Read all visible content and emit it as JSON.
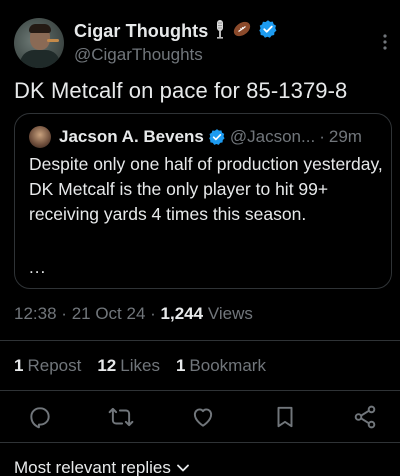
{
  "author": {
    "display_name": "Cigar Thoughts",
    "handle": "@CigarThoughts",
    "badges": [
      "microphone-icon",
      "football-icon",
      "verified-badge-icon"
    ]
  },
  "tweet": {
    "text": "DK Metcalf on pace for 85-1379-8"
  },
  "quote": {
    "display_name": "Jacson A. Bevens",
    "handle": "@Jacson...",
    "separator": "·",
    "time": "29m",
    "text": "Despite only one half of production yesterday, DK Metcalf is the only player to hit 99+ receiving yards 4 times this season.",
    "ellipsis": "..."
  },
  "meta": {
    "time": "12:38",
    "date": "21 Oct 24",
    "separator": "·",
    "views_count": "1,244",
    "views_label": "Views"
  },
  "stats": {
    "reposts_count": "1",
    "reposts_label": "Repost",
    "likes_count": "12",
    "likes_label": "Likes",
    "bookmarks_count": "1",
    "bookmarks_label": "Bookmark"
  },
  "actions": [
    "reply-icon",
    "repost-icon",
    "like-icon",
    "bookmark-icon",
    "share-icon"
  ],
  "replies": {
    "sort_label": "Most relevant replies"
  },
  "colors": {
    "background": "#000000",
    "text": "#e7e9ea",
    "muted": "#71767b",
    "border": "#2f3336",
    "verified": "#1d9bf0"
  }
}
